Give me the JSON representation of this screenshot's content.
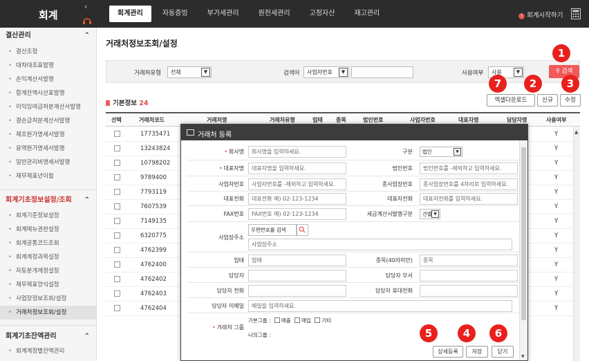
{
  "app": {
    "title": "회계",
    "top_tabs": [
      "회계관리",
      "자동증빙",
      "부가세관리",
      "원천세관리",
      "고정자산",
      "재고관리"
    ],
    "start_link": "회계시작하기"
  },
  "sidebar": {
    "section1": {
      "title": "결산관리",
      "items": [
        "결산조정",
        "대차대조표발행",
        "손익계산서발행",
        "합계잔액시산표발행",
        "이익잉여금처분계산서발행",
        "결손금처분계산서발행",
        "제조원가명세서발행",
        "용역원가명세서발행",
        "일반관리비명세서발행",
        "재무제표년이월"
      ]
    },
    "section2": {
      "title": "회계기초정보설정/조회",
      "items": [
        "회계기준정보설정",
        "회계메뉴권한설정",
        "회계공통코드조회",
        "회계계정과목설정",
        "자동분개계정설정",
        "재무제표양식설정",
        "사업장정보조회/설정",
        "거래처정보조회/설정"
      ]
    },
    "section3": {
      "title": "회계기초잔액관리",
      "items": [
        "회계계정별잔액관리"
      ]
    }
  },
  "page": {
    "title": "거래처정보조회/설정",
    "filters": {
      "type_label": "거래처유형",
      "type_value": "전체",
      "keyword_label": "검색어",
      "keyword_type": "사업자번호",
      "keyword_value": "",
      "use_label": "사용여부",
      "use_value": "사용",
      "search_button": "검색"
    },
    "count_label": "기본정보",
    "count_value": "24",
    "buttons": {
      "excel": "엑셀다운로드",
      "new": "신규",
      "edit": "수정"
    }
  },
  "grid": {
    "headers": [
      "선택",
      "거래처코드",
      "거래처명",
      "거래처유형",
      "업태",
      "종목",
      "법인번호",
      "사업자번호",
      "대표자명",
      "담당자명",
      "사용여부"
    ],
    "rows": [
      {
        "code": "17735471",
        "use": "Y"
      },
      {
        "code": "13243824",
        "use": "Y"
      },
      {
        "code": "10798202",
        "use": "Y"
      },
      {
        "code": "9789400",
        "use": "Y"
      },
      {
        "code": "7793119",
        "use": "Y"
      },
      {
        "code": "7607539",
        "use": "Y"
      },
      {
        "code": "7149135",
        "use": "Y"
      },
      {
        "code": "6320775",
        "use": "Y"
      },
      {
        "code": "4762399",
        "use": "Y"
      },
      {
        "code": "4762400",
        "use": "Y"
      },
      {
        "code": "4762402",
        "use": "Y"
      },
      {
        "code": "4762403",
        "use": "Y"
      },
      {
        "code": "4762404",
        "use": "Y"
      }
    ]
  },
  "modal": {
    "title": "거래처 등록",
    "company_label": "회사명",
    "company_ph": "회사명을 입력하세요.",
    "type_label": "구분",
    "type_value": "법인",
    "ceo_label": "대표자명",
    "ceo_ph": "대표자명을 입력하세요.",
    "corpno_label": "법인번호",
    "corpno_ph": "법인번호를 -제외하고 입력하세요.",
    "bizno_label": "사업자번호",
    "bizno_ph": "사업자번호를 -제외하고 입력하세요.",
    "branch_label": "종사업장번호",
    "branch_ph": "종사업장번호를 4자리로 입력하세요.",
    "ceotel_label": "대표전화",
    "ceotel_ph": "대표전화 예) 02-123-1234",
    "ceophone_label": "대표자전화",
    "ceophone_ph": "대표자전화를 입력하세요.",
    "fax_label": "FAX번호",
    "fax_ph": "FAX번호 예) 02-123-1234",
    "taxunit_label": "세금계산서발행구분",
    "taxunit_value": "건별",
    "addr_label": "사업장주소",
    "zip_button": "우편번호를 검색",
    "addr_ph": "사업장주소",
    "biztype_label": "업태",
    "biztype_ph": "업태",
    "item_label": "종목(40자미만)",
    "item_ph": "종목",
    "manager_label": "담당자",
    "dept_label": "담당자 부서",
    "mgrtel_label": "담당자 전화",
    "mgrmobile_label": "담당자 휴대전화",
    "email_label": "담당자 이메일",
    "email_ph": "메일을 입력하세요.",
    "group_label": "거래처 그룹",
    "basic_group_label": "기본그룹 :",
    "opt_sale": "매출",
    "opt_buy": "매입",
    "opt_etc": "기타",
    "my_group_label": "나의그룹 :",
    "btn_detail": "상세등록",
    "btn_save": "저장",
    "btn_close": "닫기"
  },
  "markers": [
    "1",
    "2",
    "3",
    "4",
    "5",
    "6",
    "7"
  ],
  "colors": {
    "accent": "#f05a5a",
    "marker": "#e8211d",
    "topbar": "#2c2c2c",
    "active_section": "#c9302c"
  }
}
